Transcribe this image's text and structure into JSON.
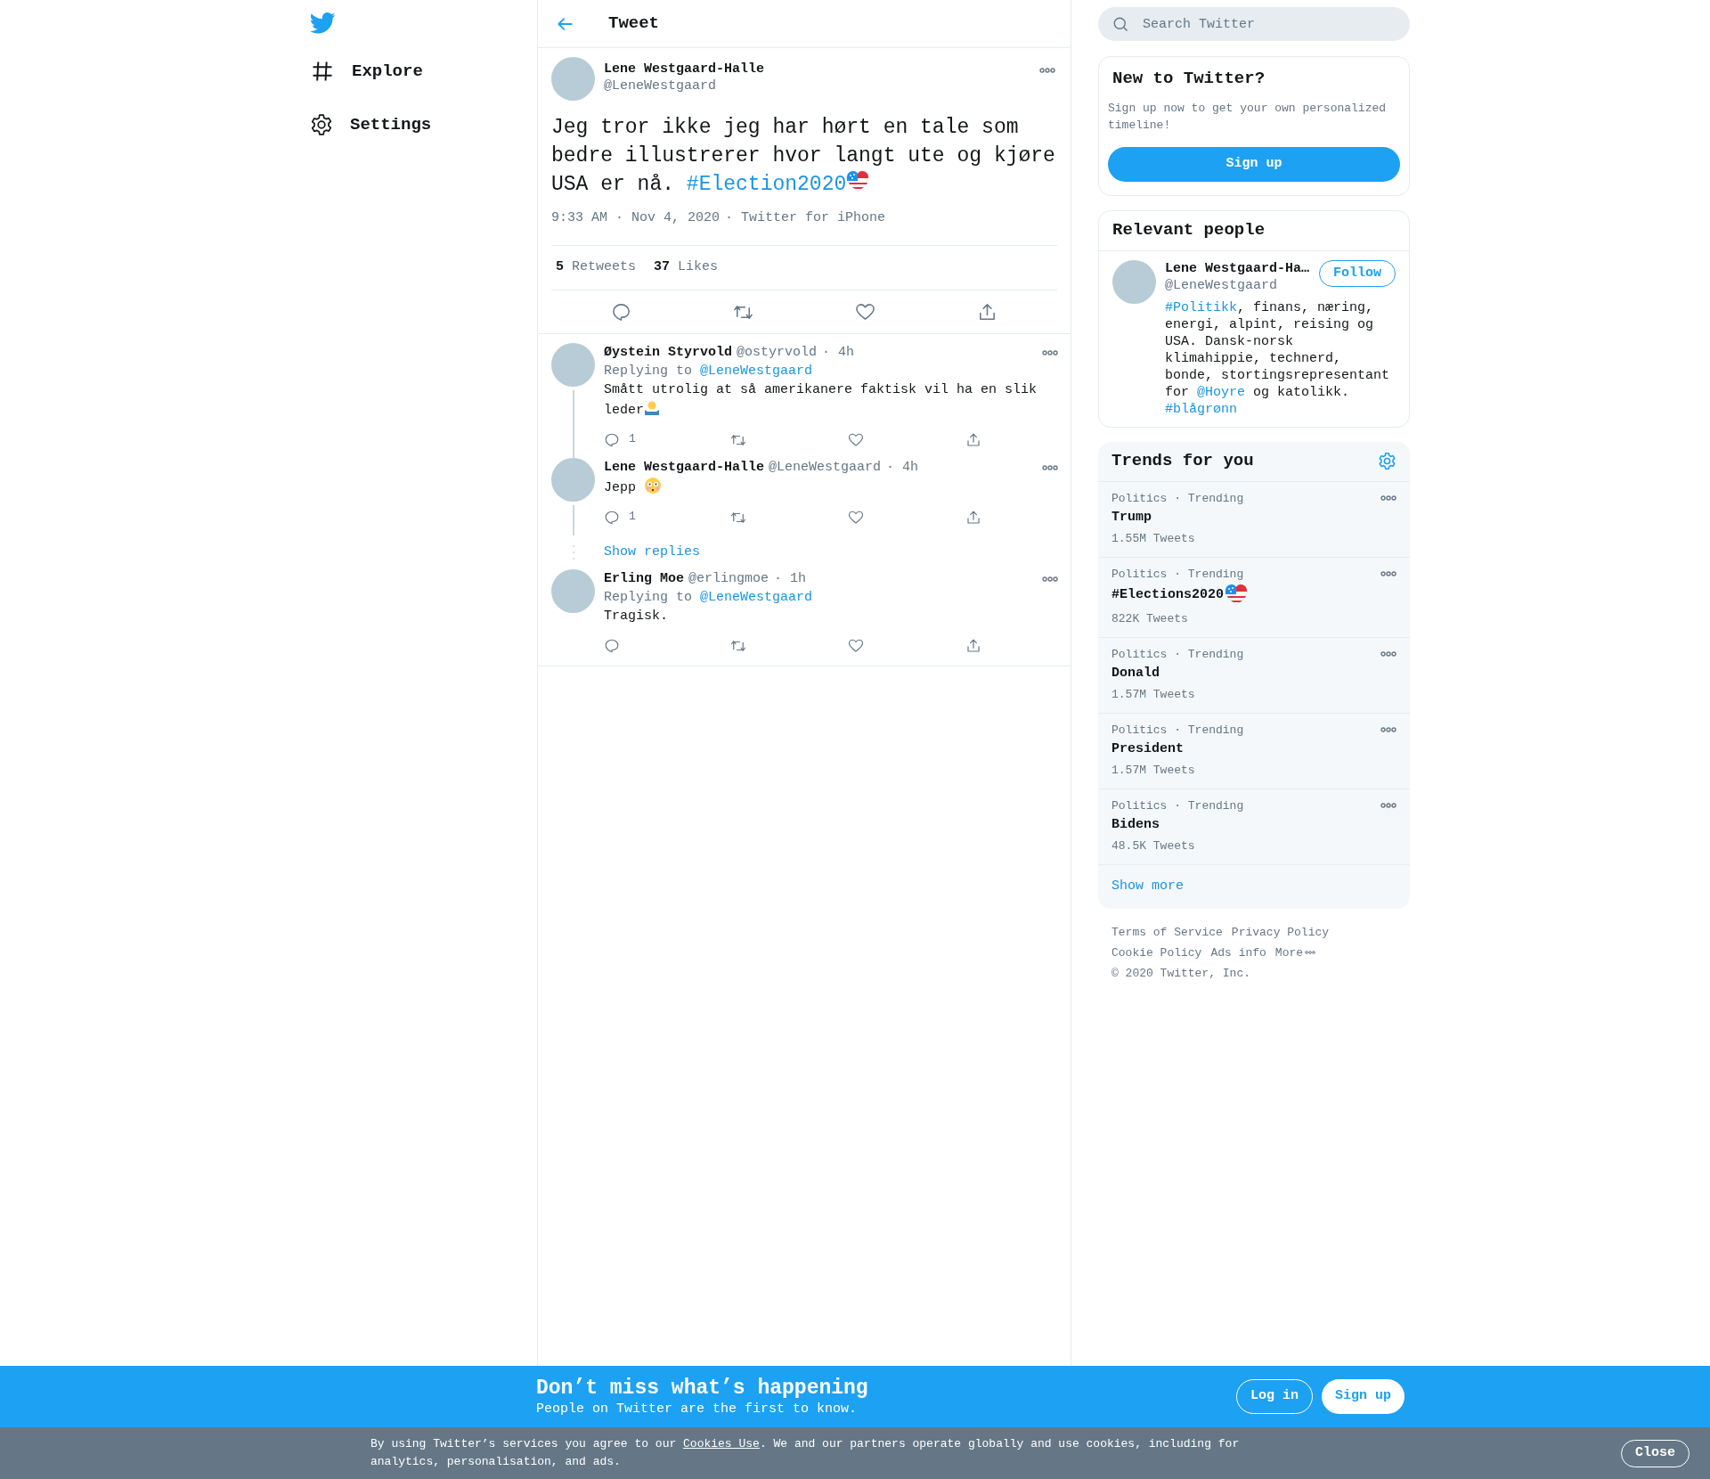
{
  "nav": {
    "items": [
      {
        "kind": "explore",
        "label": "Explore"
      },
      {
        "kind": "settings",
        "label": "Settings"
      }
    ]
  },
  "header": {
    "title": "Tweet"
  },
  "main_tweet": {
    "name": "Lene Westgaard-Halle",
    "handle": "@LeneWestgaard",
    "text": [
      {
        "kind": "text",
        "text": "Jeg tror ikke jeg har hørt en tale som bedre illustrerer hvor langt ute og kjøre USA er nå. "
      },
      {
        "kind": "hashtag",
        "text": "#Election2020"
      },
      {
        "kind": "hashflag"
      }
    ],
    "time": "9:33 AM · Nov 4, 2020",
    "source": "· Twitter for iPhone",
    "stats": [
      {
        "count": "5",
        "label": "Retweets"
      },
      {
        "count": "37",
        "label": "Likes"
      }
    ]
  },
  "replies": [
    {
      "name": "Øystein Styrvold",
      "handle": "@ostyrvold",
      "time": "· 4h",
      "replying_label": "Replying to",
      "replying_to": "@LeneWestgaard",
      "text": [
        {
          "kind": "text",
          "text": "Smått utrolig at så amerikanere faktisk vil ha en slik leder"
        },
        {
          "kind": "shrug"
        }
      ],
      "reply_count": "1",
      "thread_line": true
    },
    {
      "name": "Lene Westgaard-Halle",
      "handle": "@LeneWestgaard",
      "time": "· 4h",
      "text": [
        {
          "kind": "text",
          "text": "Jepp "
        },
        {
          "kind": "flushed"
        }
      ],
      "reply_count": "1",
      "thread_line": true,
      "show_replies": "Show replies"
    },
    {
      "name": "Erling Moe",
      "handle": "@erlingmoe",
      "time": "· 1h",
      "replying_label": "Replying to",
      "replying_to": "@LeneWestgaard",
      "text": [
        {
          "kind": "text",
          "text": "Tragisk."
        }
      ],
      "thread_line": false
    }
  ],
  "search": {
    "placeholder": "Search Twitter"
  },
  "signup_card": {
    "title": "New to Twitter?",
    "text": "Sign up now to get your own personalized timeline!",
    "button": "Sign up"
  },
  "people_card": {
    "title": "Relevant people",
    "person": {
      "name": "Lene Westgaard-Ha…",
      "handle": "@LeneWestgaard",
      "button": "Follow",
      "bio": [
        {
          "kind": "hashtag",
          "text": "#Politikk"
        },
        {
          "kind": "text",
          "text": ", finans, næring, energi, alpint, reising og USA. Dansk-norsk klimahippie, technerd, bonde, stortingsrepresentant for "
        },
        {
          "kind": "hashtag",
          "text": "@Hoyre"
        },
        {
          "kind": "text",
          "text": " og katolikk. "
        },
        {
          "kind": "hashtag",
          "text": "#blågrønn"
        }
      ]
    }
  },
  "trends": {
    "title": "Trends for you",
    "items": [
      {
        "meta": "Politics · Trending",
        "name": "Trump",
        "hashflag": false,
        "count": "1.55M Tweets"
      },
      {
        "meta": "Politics · Trending",
        "name": "#Elections2020",
        "hashflag": true,
        "count": "822K Tweets"
      },
      {
        "meta": "Politics · Trending",
        "name": "Donald",
        "hashflag": false,
        "count": "1.57M Tweets"
      },
      {
        "meta": "Politics · Trending",
        "name": "President",
        "hashflag": false,
        "count": "1.57M Tweets"
      },
      {
        "meta": "Politics · Trending",
        "name": "Bidens",
        "hashflag": false,
        "count": "48.5K Tweets"
      }
    ],
    "show_more": "Show more"
  },
  "footer": {
    "links": [
      "Terms of Service",
      "Privacy Policy",
      "Cookie Policy",
      "Ads info",
      "More"
    ],
    "copyright": "© 2020 Twitter, Inc."
  },
  "banner": {
    "title": "Don’t miss what’s happening",
    "subtitle": "People on Twitter are the first to know.",
    "login": "Log in",
    "signup": "Sign up"
  },
  "cookie": {
    "before": "By using Twitter’s services you agree to our ",
    "link": "Cookies Use",
    "after": ". We and our partners operate globally and use cookies, including for analytics, personalisation, and ads.",
    "close": "Close"
  }
}
